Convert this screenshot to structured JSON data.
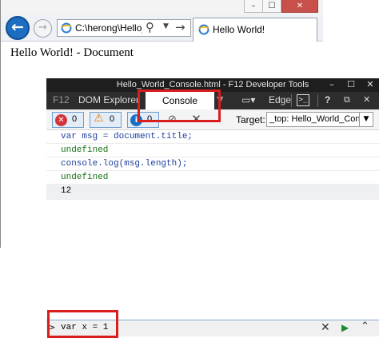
{
  "browser": {
    "address": "C:\\herong\\Hello_V",
    "tab_title": "Hello World!",
    "page_heading": "Hello World! - Document",
    "window_controls": {
      "minimize": "–",
      "maximize": "☐",
      "close": "✕"
    }
  },
  "devtools": {
    "title": "Hello_World_Console.html - F12 Developer Tools",
    "tabs": [
      "F12",
      "DOM Explorer",
      "Console",
      "Edge"
    ],
    "active_tab": "Console",
    "toolbar": {
      "errors_count": "0",
      "warnings_count": "0",
      "messages_count": "0",
      "target_label": "Target:",
      "target_value": "_top: Hello_World_Cons"
    },
    "console_lines": [
      {
        "kind": "input",
        "text": "var msg = document.title;"
      },
      {
        "kind": "output",
        "text": "undefined"
      },
      {
        "kind": "input",
        "text": "console.log(msg.length);"
      },
      {
        "kind": "output",
        "text": "undefined"
      },
      {
        "kind": "result",
        "text": "12"
      }
    ],
    "input_value": "var x = 1"
  },
  "colors": {
    "annotation": "#d91e1e",
    "devtools_dark": "#1e1e1e",
    "console_input_text": "#1e3f9e",
    "console_undefined_text": "#197119"
  },
  "icons": [
    "back-arrow-icon",
    "forward-arrow-icon",
    "ie-favicon-icon",
    "search-icon",
    "go-arrow-icon",
    "error-icon",
    "warning-icon",
    "info-icon",
    "clear-icon",
    "run-icon",
    "expand-icon"
  ]
}
